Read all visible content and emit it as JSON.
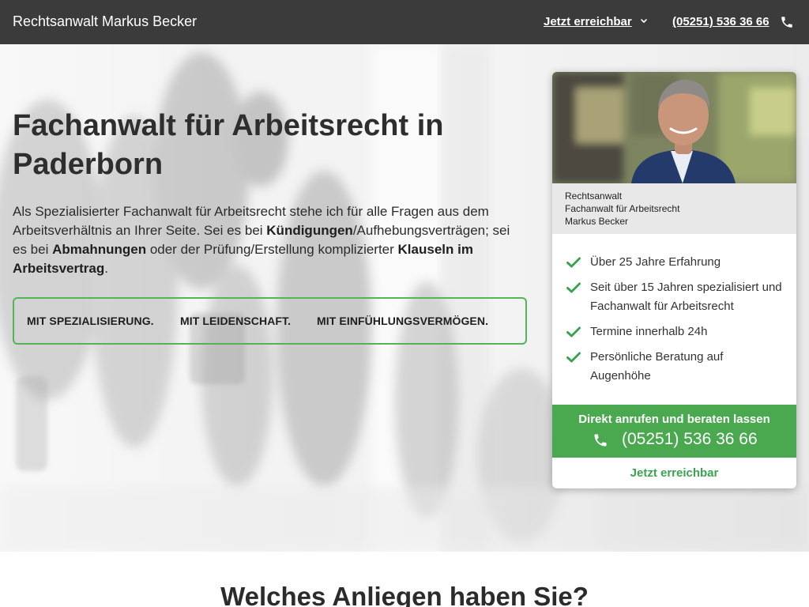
{
  "header": {
    "brand": "Rechtsanwalt Markus Becker",
    "availability_link": "Jetzt erreichbar",
    "phone": "(05251) 536 36 66"
  },
  "hero": {
    "title": "Fachanwalt für Arbeitsrecht in Paderborn",
    "intro": {
      "p1": "Als Spezialisierter Fachanwalt für Arbeitsrecht stehe ich für alle Fragen aus dem Arbeitsverhältnis an Ihrer Seite. Sei es bei ",
      "b1": "Kündigungen",
      "p2": "/Aufhebungsverträgen; sei es bei ",
      "b2": "Abmahnungen",
      "p3": " oder der Prüfung/Erstellung komplizierter ",
      "b3": "Klauseln im Arbeitsvertrag",
      "p4": "."
    },
    "values": [
      "MIT SPEZIALISIERUNG.",
      "MIT LEIDENSCHAFT.",
      "MIT EINFÜHLUNGSVERMÖGEN."
    ]
  },
  "card": {
    "role_lines": [
      "Rechtsanwalt",
      "Fachanwalt für Arbeitsrecht",
      "Markus Becker"
    ],
    "features": [
      "Über 25 Jahre Erfahrung",
      "Seit über 15 Jahren spezialisiert und Fachanwalt für Arbeitsrecht",
      "Termine innerhalb 24h",
      "Persönliche Beratung auf Augenhöhe"
    ],
    "cta_label": "Direkt anrufen und beraten lassen",
    "cta_phone": "(05251) 536 36 66",
    "availability": "Jetzt erreichbar"
  },
  "next_section": {
    "title": "Welches Anliegen haben Sie?"
  },
  "colors": {
    "topbar": "#3b3b3b",
    "accent_green": "#4aa84f",
    "check_green": "#3aa351"
  },
  "icons": [
    "chevron-down-icon",
    "phone-icon",
    "check-icon"
  ]
}
